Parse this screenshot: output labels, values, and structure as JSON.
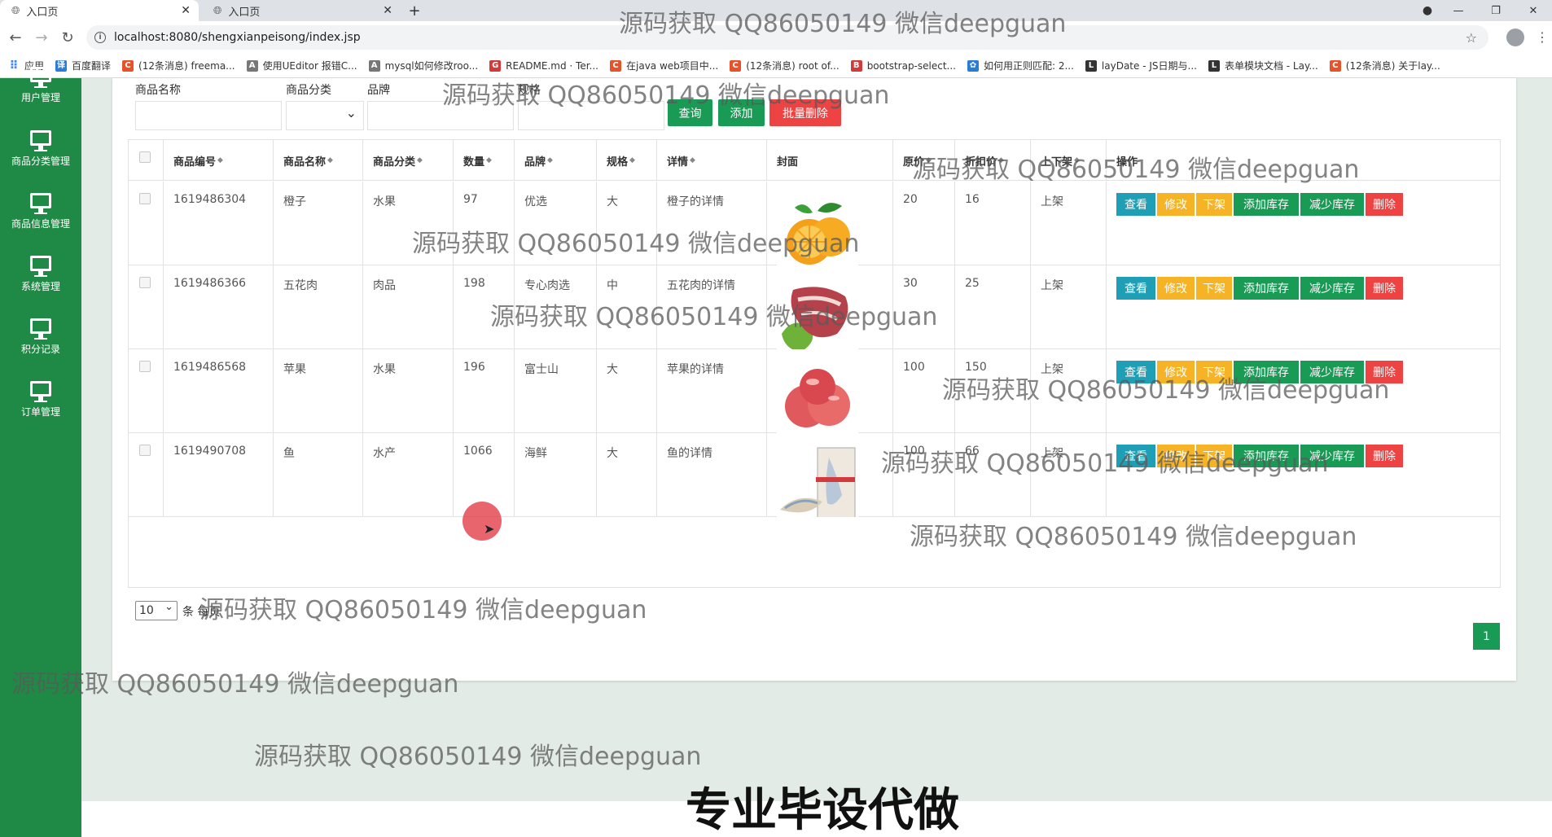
{
  "browser": {
    "tabs": [
      {
        "title": "入口页",
        "active": true
      },
      {
        "title": "入口页",
        "active": false
      }
    ],
    "url": "localhost:8080/shengxianpeisong/index.jsp",
    "bookmarks": [
      {
        "label": "应用",
        "icon": "apps-icon"
      },
      {
        "label": "百度翻译",
        "icon": "baidu-translate-icon"
      },
      {
        "label": "(12条消息) freema...",
        "icon": "csdn-icon"
      },
      {
        "label": "使用UEditor 报错C...",
        "icon": "site-icon"
      },
      {
        "label": "mysql如何修改roo...",
        "icon": "site-icon"
      },
      {
        "label": "README.md · Ter...",
        "icon": "gitee-icon"
      },
      {
        "label": "在java web项目中...",
        "icon": "csdn-icon"
      },
      {
        "label": "(12条消息) root of...",
        "icon": "csdn-icon"
      },
      {
        "label": "bootstrap-select...",
        "icon": "site-icon"
      },
      {
        "label": "如何用正则匹配: 2...",
        "icon": "baidu-icon"
      },
      {
        "label": "layDate - JS日期与...",
        "icon": "layui-icon"
      },
      {
        "label": "表单模块文档 - Lay...",
        "icon": "layui-icon"
      },
      {
        "label": "(12条消息) 关于lay...",
        "icon": "csdn-icon"
      }
    ]
  },
  "sidebar": {
    "items": [
      {
        "label": "用户管理",
        "icon": "monitor-icon"
      },
      {
        "label": "商品分类管理",
        "icon": "monitor-icon"
      },
      {
        "label": "商品信息管理",
        "icon": "monitor-icon"
      },
      {
        "label": "系统管理",
        "icon": "monitor-icon"
      },
      {
        "label": "积分记录",
        "icon": "monitor-icon"
      },
      {
        "label": "订单管理",
        "icon": "monitor-icon"
      }
    ]
  },
  "filters": {
    "name_label": "商品名称",
    "category_label": "商品分类",
    "brand_label": "品牌",
    "spec_label": "规格",
    "query_button": "查询",
    "add_button": "添加",
    "batch_delete_button": "批量删除"
  },
  "table": {
    "columns": [
      "商品编号",
      "商品名称",
      "商品分类",
      "数量",
      "品牌",
      "规格",
      "详情",
      "封面",
      "原价",
      "折扣价",
      "上下架",
      "操作"
    ],
    "rows": [
      {
        "id": "1619486304",
        "name": "橙子",
        "category": "水果",
        "qty": "97",
        "brand": "优选",
        "spec": "大",
        "detail": "橙子的详情",
        "cover": "orange",
        "price": "20",
        "discount": "16",
        "status": "上架"
      },
      {
        "id": "1619486366",
        "name": "五花肉",
        "category": "肉品",
        "qty": "198",
        "brand": "专心肉选",
        "spec": "中",
        "detail": "五花肉的详情",
        "cover": "pork",
        "price": "30",
        "discount": "25",
        "status": "上架"
      },
      {
        "id": "1619486568",
        "name": "苹果",
        "category": "水果",
        "qty": "196",
        "brand": "富士山",
        "spec": "大",
        "detail": "苹果的详情",
        "cover": "apple",
        "price": "100",
        "discount": "150",
        "status": "上架"
      },
      {
        "id": "1619490708",
        "name": "鱼",
        "category": "水产",
        "qty": "1066",
        "brand": "海鲜",
        "spec": "大",
        "detail": "鱼的详情",
        "cover": "fish",
        "price": "100",
        "discount": "66",
        "status": "上架"
      }
    ],
    "actions": {
      "view": "查看",
      "edit": "修改",
      "offshelf": "下架",
      "add_stock": "添加库存",
      "reduce_stock": "减少库存",
      "delete": "删除"
    }
  },
  "pagination": {
    "page_size": "10",
    "page_size_label": "条 每页",
    "current_page": "1"
  },
  "watermark": "源码获取 QQ86050149 微信deepguan",
  "promo": "专业毕设代做",
  "colors": {
    "sidebar": "#1f8a45",
    "primary": "#199a55",
    "danger": "#ed4343",
    "warning": "#f6b325",
    "info": "#1e9fb5"
  }
}
